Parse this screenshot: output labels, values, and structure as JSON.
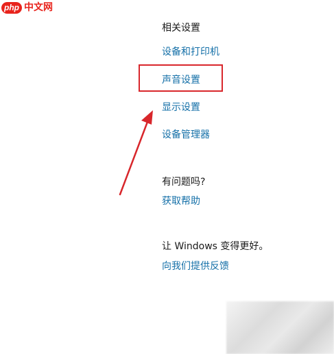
{
  "watermark": {
    "badge": "php",
    "text": "中文网"
  },
  "related": {
    "heading": "相关设置",
    "links": [
      "设备和打印机",
      "声音设置",
      "显示设置",
      "设备管理器"
    ]
  },
  "help": {
    "heading": "有问题吗?",
    "link": "获取帮助"
  },
  "feedback": {
    "heading": "让 Windows 变得更好。",
    "link": "向我们提供反馈"
  },
  "colors": {
    "link": "#1570a8",
    "annotation": "#d8262b"
  }
}
